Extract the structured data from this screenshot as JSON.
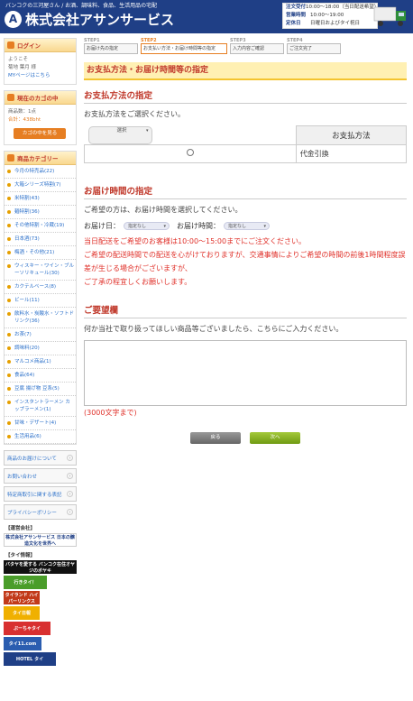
{
  "header": {
    "tagline": "バンコクの三河屋さん / お酒、調味料、食品、生活用品の宅配",
    "logo_mark": "A",
    "logo_text": "株式会社アサンサービス",
    "hours": [
      {
        "k": "注文受付",
        "v": "10:00～18:00（当日配送希望）"
      },
      {
        "k": "営業時間",
        "v": "10:00～19:00"
      },
      {
        "k": "定休日",
        "v": "日曜日およびタイ祝日"
      }
    ]
  },
  "login": {
    "title": "ログイン",
    "welcome": "ようこそ",
    "user": "菊地 葉月 様",
    "mypage": "MYページはこちら"
  },
  "cart": {
    "title": "現在のカゴの中",
    "count": "商品数：1点",
    "total": "合計：438bht",
    "button": "カゴの中を見る"
  },
  "categories": {
    "title": "商品カテゴリー",
    "items": [
      "今月の特売品(22)",
      "大箱シリーズ特割(7)",
      "米特割(43)",
      "麺特割(36)",
      "その他特割・冷蔵(19)",
      "日本酒(73)",
      "梅酒・その他(21)",
      "ウィスキー・ワイン・ブルーソリキュール(30)",
      "カクテルベース(8)",
      "ビール(11)",
      "飲料水・炭酸水・ソフトドリンク(36)",
      "お茶(7)",
      "調味料(20)",
      "マルコメ商品(1)",
      "食品(64)",
      "豆腐 揚げ物 豆系(5)",
      "インスタントラーメン カップラーメン(1)",
      "甘味・デザート(4)",
      "生活用品(6)"
    ]
  },
  "side_nav": [
    "商品のお届けについて",
    "お問い合わせ",
    "特定商取引に関する表記",
    "プライバシーポリシー"
  ],
  "related": {
    "company_label": "【運営会社】",
    "company_logo": "株式会社アサンサービス 日本の醸造文化を世界へ",
    "info_label": "【タイ情報】",
    "banners": [
      {
        "text": "バタヤを愛する バンコク在住オヤジのボヤキ",
        "color": "#111111"
      },
      {
        "text": "行きタイ！",
        "color": "#4a9d2a"
      },
      {
        "text": "タイランド ハイパーリンクス",
        "color": "#c23a1a"
      },
      {
        "text": "タイ日報",
        "color": "#f0b000"
      },
      {
        "text": "ぷーちゃタイ",
        "color": "#d83030"
      },
      {
        "text": "タイ11.com",
        "color": "#2b5db0"
      },
      {
        "text": "HOTEL タイ",
        "color": "#1f3f86"
      }
    ]
  },
  "steps": [
    {
      "no": "STEP1",
      "label": "お届け先の指定",
      "current": false
    },
    {
      "no": "STEP2",
      "label": "お支払い方法・お届け時間等の指定",
      "current": true
    },
    {
      "no": "STEP3",
      "label": "入力内容ご確認",
      "current": false
    },
    {
      "no": "STEP4",
      "label": "ご注文完了",
      "current": false
    }
  ],
  "page_title": "お支払方法・お届け時間等の指定",
  "payment": {
    "heading": "お支払方法の指定",
    "instruction": "お支払方法をご選択ください。",
    "col_select": "選択",
    "col_method": "お支払方法",
    "option": "代金引換"
  },
  "delivery": {
    "heading": "お届け時間の指定",
    "instruction": "ご希望の方は、お届け時間を選択してください。",
    "date_label": "お届け日：",
    "date_value": "指定なし",
    "time_label": "お届け時間：",
    "time_value": "指定なし",
    "notes": [
      "当日配送をご希望のお客様は10:00～15:00までにご注文ください。",
      "ご希望の配送時間での配送を心がけておりますが、交通事情によりご希望の時間の前後1時間程度誤差が生じる場合がございますが、",
      "ご了承の程宜しくお願いします。"
    ]
  },
  "request": {
    "heading": "ご要望欄",
    "instruction": "何か当社で取り扱ってほしい商品等ございましたら、こちらにご入力ください。",
    "limit": "(3000文字まで)"
  },
  "buttons": {
    "back": "戻る",
    "next": "次へ"
  }
}
